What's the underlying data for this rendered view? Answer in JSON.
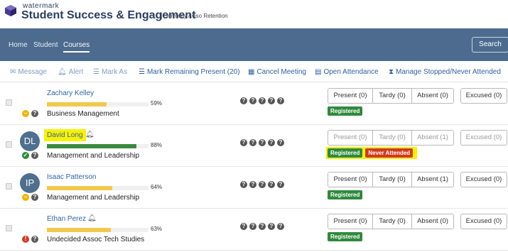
{
  "brand": {
    "small": "watermark",
    "title": "Student Success & Engagement",
    "separator": "|",
    "formerly": "formerly Aviso Retention"
  },
  "nav": {
    "items": [
      {
        "label": "Home"
      },
      {
        "label": "Student"
      },
      {
        "label": "Courses"
      }
    ],
    "active": "Courses",
    "search_label": "Search"
  },
  "toolbar": {
    "message": "Message",
    "alert": "Alert",
    "mark_as": "Mark As",
    "mark_remaining": "Mark Remaining Present (20)",
    "cancel_meeting": "Cancel Meeting",
    "open_attendance": "Open Attendance",
    "manage_stopped": "Manage Stopped/Never Attended"
  },
  "students": [
    {
      "name": "Zachary Kelley",
      "avatar": "",
      "progress": 59,
      "progress_label": "59%",
      "progress_color": "#f2c94c",
      "course": "Business Management",
      "status_icon": "minus-circle",
      "status_color": "#f2b400",
      "present": "Present (0)",
      "tardy": "Tardy (0)",
      "absent": "Absent (0)",
      "excused": "Excused (0)",
      "badges": [
        {
          "label": "Registered",
          "color": "green"
        }
      ]
    },
    {
      "name": "David Long",
      "avatar": "DL",
      "progress": 88,
      "progress_label": "88%",
      "progress_color": "#3a8a3e",
      "course": "Management and Leadership",
      "status_icon": "check-circle",
      "status_color": "#2f8a3c",
      "present": "Present (0)",
      "tardy": "Tardy (0)",
      "absent": "Absent (1)",
      "excused": "Excused (0)",
      "badges": [
        {
          "label": "Registered",
          "color": "green"
        },
        {
          "label": "Never Attended",
          "color": "red"
        }
      ]
    },
    {
      "name": "Isaac Patterson",
      "avatar": "IP",
      "progress": 64,
      "progress_label": "64%",
      "progress_color": "#f2c94c",
      "course": "Management and Leadership",
      "status_icon": "minus-circle",
      "status_color": "#f2b400",
      "present": "Present (0)",
      "tardy": "Tardy (0)",
      "absent": "Absent (1)",
      "excused": "Excused (0)",
      "badges": [
        {
          "label": "Registered",
          "color": "green"
        }
      ]
    },
    {
      "name": "Ethan Perez",
      "avatar": "",
      "progress": 63,
      "progress_label": "63%",
      "progress_color": "#f2c94c",
      "course": "Undecided Assoc Tech Studies",
      "status_icon": "exclamation-circle",
      "status_color": "#d23a20",
      "present": "Present (0)",
      "tardy": "Tardy (0)",
      "absent": "Absent (0)",
      "excused": "Excused (0)",
      "badges": [
        {
          "label": "Registered",
          "color": "green"
        }
      ]
    }
  ]
}
